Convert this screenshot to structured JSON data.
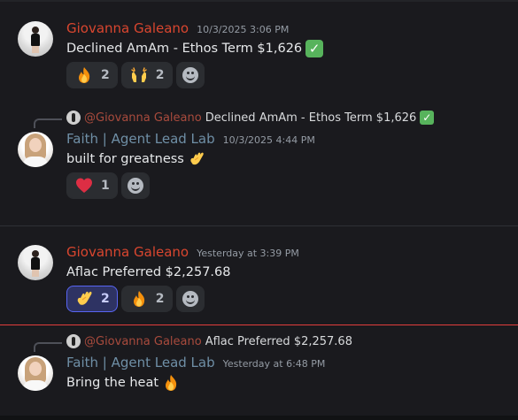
{
  "messages": [
    {
      "author": "Giovanna Galeano",
      "timestamp": "10/3/2025 3:06 PM",
      "text": "Declined AmAm - Ethos Term $1,626",
      "reactions": [
        {
          "emoji": "fire-icon",
          "count": "2"
        },
        {
          "emoji": "raising-hands-icon",
          "count": "2"
        }
      ]
    },
    {
      "reply_to": {
        "author": "@Giovanna Galeano",
        "text": "Declined AmAm - Ethos Term $1,626"
      },
      "author": "Faith | Agent Lead Lab",
      "timestamp": "10/3/2025 4:44 PM",
      "text": "built for greatness",
      "reactions": [
        {
          "emoji": "red-heart-icon",
          "count": "1"
        }
      ]
    },
    {
      "author": "Giovanna Galeano",
      "timestamp": "Yesterday at 3:39 PM",
      "text": "Aflac Preferred $2,257.68",
      "reactions": [
        {
          "emoji": "call-me-hand-icon",
          "count": "2",
          "active": true
        },
        {
          "emoji": "fire-icon",
          "count": "2"
        }
      ]
    },
    {
      "reply_to": {
        "author": "@Giovanna Galeano",
        "text": "Aflac Preferred $2,257.68"
      },
      "author": "Faith | Agent Lead Lab",
      "timestamp": "Yesterday at 6:48 PM",
      "text": "Bring the heat"
    }
  ],
  "colors": {
    "background": "#1a1a1e",
    "author_giovanna": "#d9462f",
    "author_faith": "#6f8fa6",
    "active_reaction_border": "#5865f2",
    "new_messages_line": "#e33d3d"
  }
}
